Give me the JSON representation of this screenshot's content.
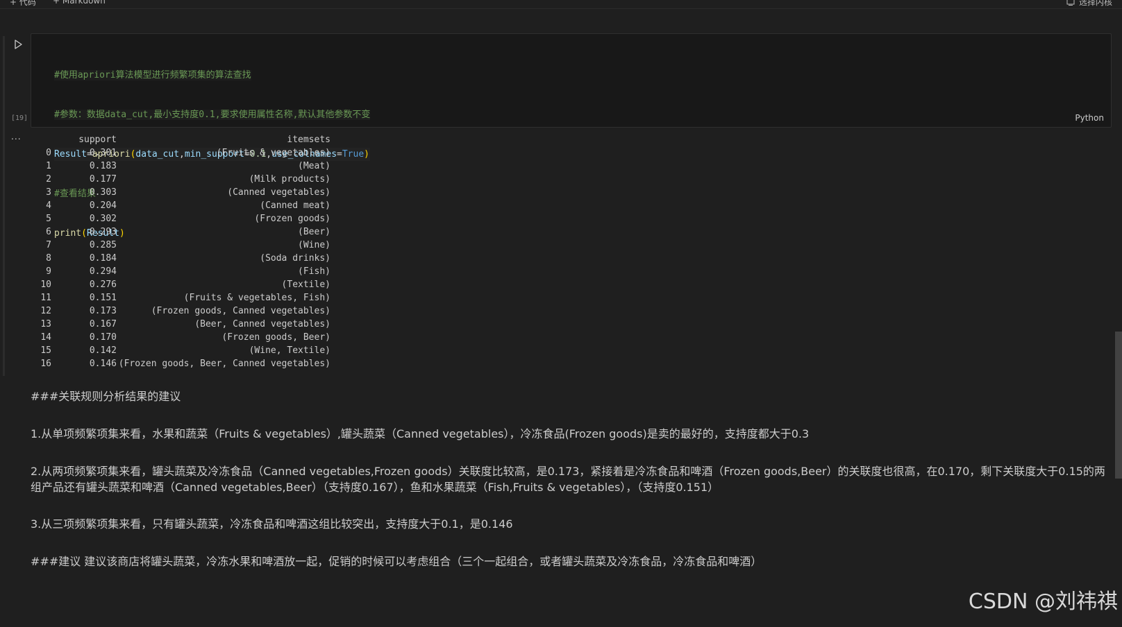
{
  "toolbar": {
    "code_label": "+ 代码",
    "markdown_label": "+ Markdown",
    "kernel_label": "选择内核"
  },
  "cell": {
    "exec_count": "[19]",
    "language": "Python",
    "code": {
      "line1": "#使用apriori算法模型进行频繁项集的算法查找",
      "line2": "#参数：数据data_cut,最小支持度0.1,要求使用属性名称,默认其他参数不变",
      "line3": {
        "result": "Result",
        "eq": "=",
        "func": "apriori",
        "lp": "(",
        "arg1": "data_cut",
        "c1": ",",
        "kw1": "min_support",
        "eq2": "=",
        "val1": "0.1",
        "c2": ",",
        "kw2": "use_colnames",
        "eq3": "=",
        "val2": "True",
        "rp": ")"
      },
      "line4": "#查看结果",
      "line5": {
        "func": "print",
        "lp": "(",
        "arg": "Result",
        "rp": ")"
      }
    }
  },
  "output": {
    "dots": "...",
    "header": {
      "support": "support",
      "itemsets": "itemsets"
    },
    "rows": [
      {
        "idx": "0",
        "support": "0.301",
        "itemsets": "(Fruits & vegetables)"
      },
      {
        "idx": "1",
        "support": "0.183",
        "itemsets": "(Meat)"
      },
      {
        "idx": "2",
        "support": "0.177",
        "itemsets": "(Milk products)"
      },
      {
        "idx": "3",
        "support": "0.303",
        "itemsets": "(Canned vegetables)"
      },
      {
        "idx": "4",
        "support": "0.204",
        "itemsets": "(Canned meat)"
      },
      {
        "idx": "5",
        "support": "0.302",
        "itemsets": "(Frozen goods)"
      },
      {
        "idx": "6",
        "support": "0.293",
        "itemsets": "(Beer)"
      },
      {
        "idx": "7",
        "support": "0.285",
        "itemsets": "(Wine)"
      },
      {
        "idx": "8",
        "support": "0.184",
        "itemsets": "(Soda drinks)"
      },
      {
        "idx": "9",
        "support": "0.294",
        "itemsets": "(Fish)"
      },
      {
        "idx": "10",
        "support": "0.276",
        "itemsets": "(Textile)"
      },
      {
        "idx": "11",
        "support": "0.151",
        "itemsets": "(Fruits & vegetables, Fish)"
      },
      {
        "idx": "12",
        "support": "0.173",
        "itemsets": "(Frozen goods, Canned vegetables)"
      },
      {
        "idx": "13",
        "support": "0.167",
        "itemsets": "(Beer, Canned vegetables)"
      },
      {
        "idx": "14",
        "support": "0.170",
        "itemsets": "(Frozen goods, Beer)"
      },
      {
        "idx": "15",
        "support": "0.142",
        "itemsets": "(Wine, Textile)"
      },
      {
        "idx": "16",
        "support": "0.146",
        "itemsets": "(Frozen goods, Beer, Canned vegetables)"
      }
    ]
  },
  "markdown": {
    "heading": "###关联规则分析结果的建议",
    "p1": "1.从单项频繁项集来看，水果和蔬菜（Fruits & vegetables）,罐头蔬菜（Canned vegetables），冷冻食品(Frozen goods)是卖的最好的，支持度都大于0.3",
    "p2": "2.从两项频繁项集来看，罐头蔬菜及冷冻食品（Canned vegetables,Frozen goods）关联度比较高，是0.173，紧接着是冷冻食品和啤酒（Frozen goods,Beer）的关联度也很高，在0.170，剩下关联度大于0.15的两组产品还有罐头蔬菜和啤酒（Canned vegetables,Beer）（支持度0.167），鱼和水果蔬菜（Fish,Fruits & vegetables），（支持度0.151）",
    "p3": "3.从三项频繁项集来看，只有罐头蔬菜，冷冻食品和啤酒这组比较突出，支持度大于0.1，是0.146",
    "p4": "###建议 建议该商店将罐头蔬菜，冷冻水果和啤酒放一起，促销的时候可以考虑组合（三个一起组合，或者罐头蔬菜及冷冻食品，冷冻食品和啤酒）"
  },
  "watermark": "CSDN @刘祎祺",
  "colors": {
    "background": "#1f1f1f",
    "cell_background": "#181818",
    "comment": "#6a9955",
    "keyword": "#569cd6",
    "function": "#dcdcaa",
    "identifier": "#9cdcfe",
    "number": "#b5cea8"
  },
  "icons": {
    "run": "play-icon",
    "kernel": "kernel-icon"
  }
}
